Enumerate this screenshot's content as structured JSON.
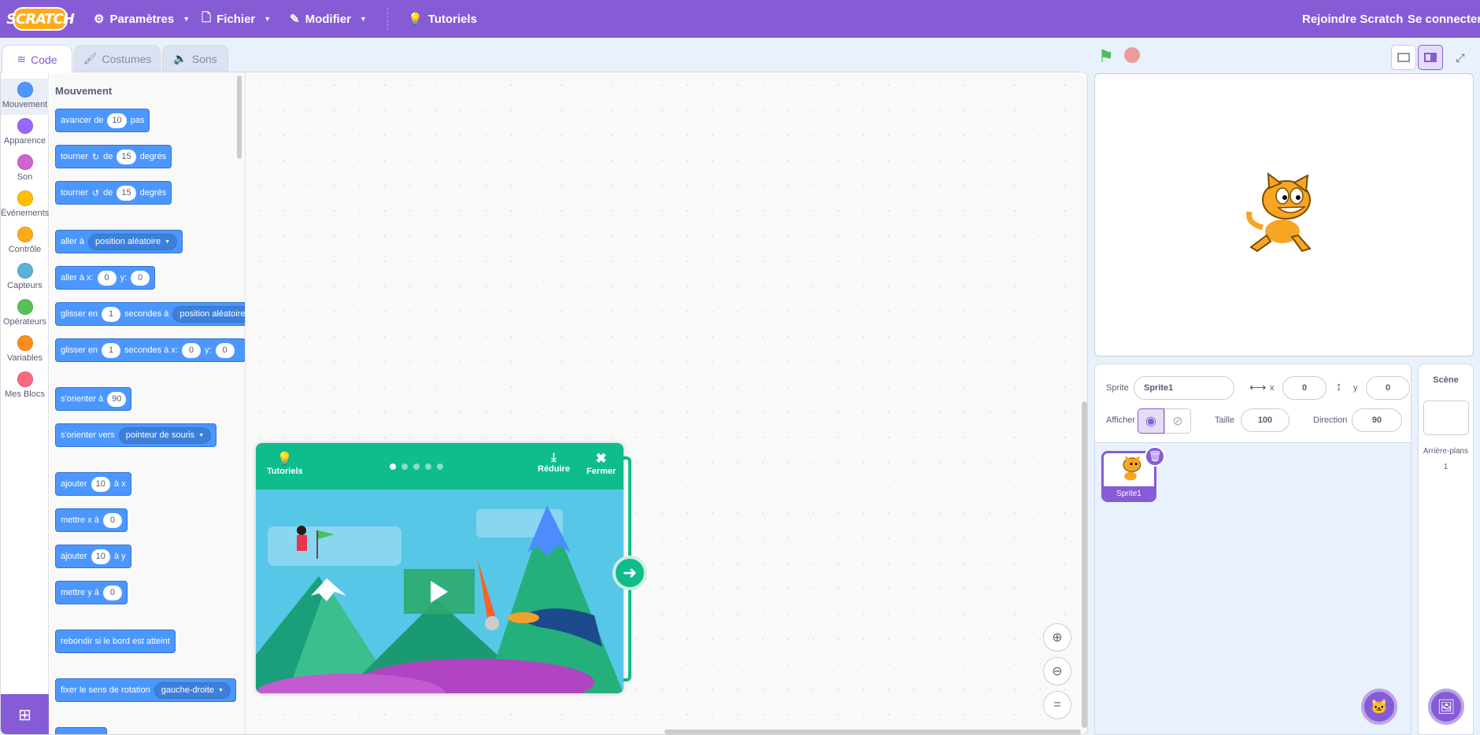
{
  "menu": {
    "logo": "SCRATCH",
    "settings": "Paramètres",
    "file": "Fichier",
    "edit": "Modifier",
    "tutorials": "Tutoriels",
    "join": "Rejoindre Scratch",
    "signin": "Se connecter"
  },
  "tabs": {
    "code": "Code",
    "costumes": "Costumes",
    "sounds": "Sons"
  },
  "categories": [
    {
      "label": "Mouvement",
      "color": "#4c97ff"
    },
    {
      "label": "Apparence",
      "color": "#9966ff"
    },
    {
      "label": "Son",
      "color": "#cf63cf"
    },
    {
      "label": "Événements",
      "color": "#ffbf00"
    },
    {
      "label": "Contrôle",
      "color": "#ffab19"
    },
    {
      "label": "Capteurs",
      "color": "#5cb1d6"
    },
    {
      "label": "Opérateurs",
      "color": "#59c059"
    },
    {
      "label": "Variables",
      "color": "#ff8c1a"
    },
    {
      "label": "Mes Blocs",
      "color": "#ff6680"
    }
  ],
  "palette": {
    "heading": "Mouvement",
    "b1": {
      "a": "avancer de",
      "v": "10",
      "b": "pas"
    },
    "b2": {
      "a": "tourner",
      "b": "de",
      "v": "15",
      "c": "degrés"
    },
    "b3": {
      "a": "tourner",
      "b": "de",
      "v": "15",
      "c": "degrés"
    },
    "b4": {
      "a": "aller à",
      "dd": "position aléatoire"
    },
    "b5": {
      "a": "aller à x:",
      "x": "0",
      "b": "y:",
      "y": "0"
    },
    "b6": {
      "a": "glisser en",
      "v": "1",
      "b": "secondes à",
      "dd": "position aléatoire"
    },
    "b7": {
      "a": "glisser en",
      "v": "1",
      "b": "secondes à x:",
      "x": "0",
      "c": "y:",
      "y": "0"
    },
    "b8": {
      "a": "s'orienter à",
      "v": "90"
    },
    "b9": {
      "a": "s'orienter vers",
      "dd": "pointeur de souris"
    },
    "b10": {
      "a": "ajouter",
      "v": "10",
      "b": "à x"
    },
    "b11": {
      "a": "mettre x à",
      "v": "0"
    },
    "b12": {
      "a": "ajouter",
      "v": "10",
      "b": "à y"
    },
    "b13": {
      "a": "mettre y à",
      "v": "0"
    },
    "b14": {
      "a": "rebondir si le bord est atteint"
    },
    "b15": {
      "a": "fixer le sens de rotation",
      "dd": "gauche-droite"
    }
  },
  "tutorial": {
    "title": "Tutoriels",
    "shrink": "Réduire",
    "close": "Fermer"
  },
  "sprite": {
    "label": "Sprite",
    "name": "Sprite1",
    "x_label": "x",
    "x": "0",
    "y_label": "y",
    "y": "0",
    "show_label": "Afficher",
    "size_label": "Taille",
    "size": "100",
    "direction_label": "Direction",
    "direction": "90",
    "thumb_name": "Sprite1"
  },
  "stage_pane": {
    "title": "Scène",
    "backdrops_label": "Arrière-plans",
    "backdrops_count": "1"
  }
}
